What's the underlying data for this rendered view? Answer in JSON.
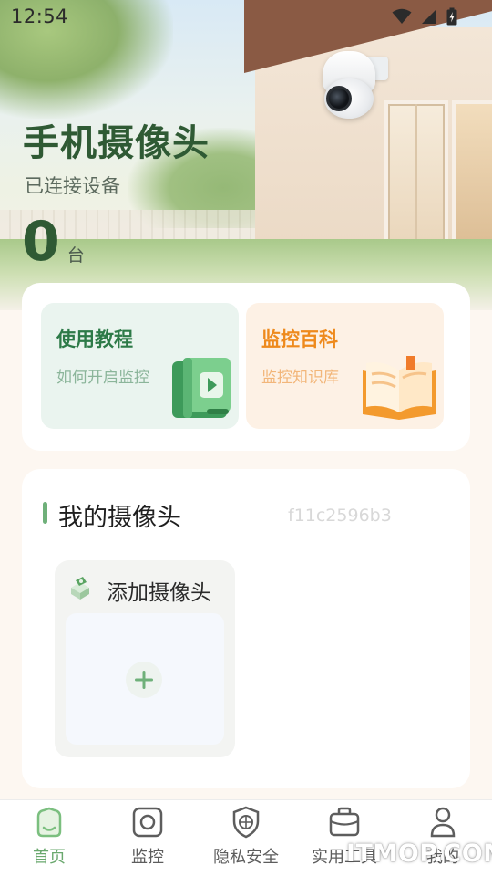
{
  "status_bar": {
    "time": "12:54"
  },
  "hero": {
    "title": "手机摄像头",
    "subtitle": "已连接设备",
    "device_count": "0",
    "device_unit": "台"
  },
  "features": [
    {
      "title": "使用教程",
      "subtitle": "如何开启监控",
      "icon": "video-book-icon",
      "accent": "#2d7a48"
    },
    {
      "title": "监控百科",
      "subtitle": "监控知识库",
      "icon": "open-book-icon",
      "accent": "#ee8a1d"
    }
  ],
  "cameras": {
    "title": "我的摄像头",
    "device_id": "f11c2596b3",
    "add_label": "添加摄像头"
  },
  "nav": [
    {
      "label": "首页",
      "icon": "home-icon",
      "active": true
    },
    {
      "label": "监控",
      "icon": "camera-icon"
    },
    {
      "label": "隐私安全",
      "icon": "shield-icon"
    },
    {
      "label": "实用工具",
      "icon": "briefcase-icon"
    },
    {
      "label": "我的",
      "icon": "user-icon"
    }
  ],
  "colors": {
    "accent_green": "#6aa86e",
    "title_green": "#2f5a34",
    "accent_orange": "#ee8a1d"
  },
  "watermark": "ITMOP.COM"
}
